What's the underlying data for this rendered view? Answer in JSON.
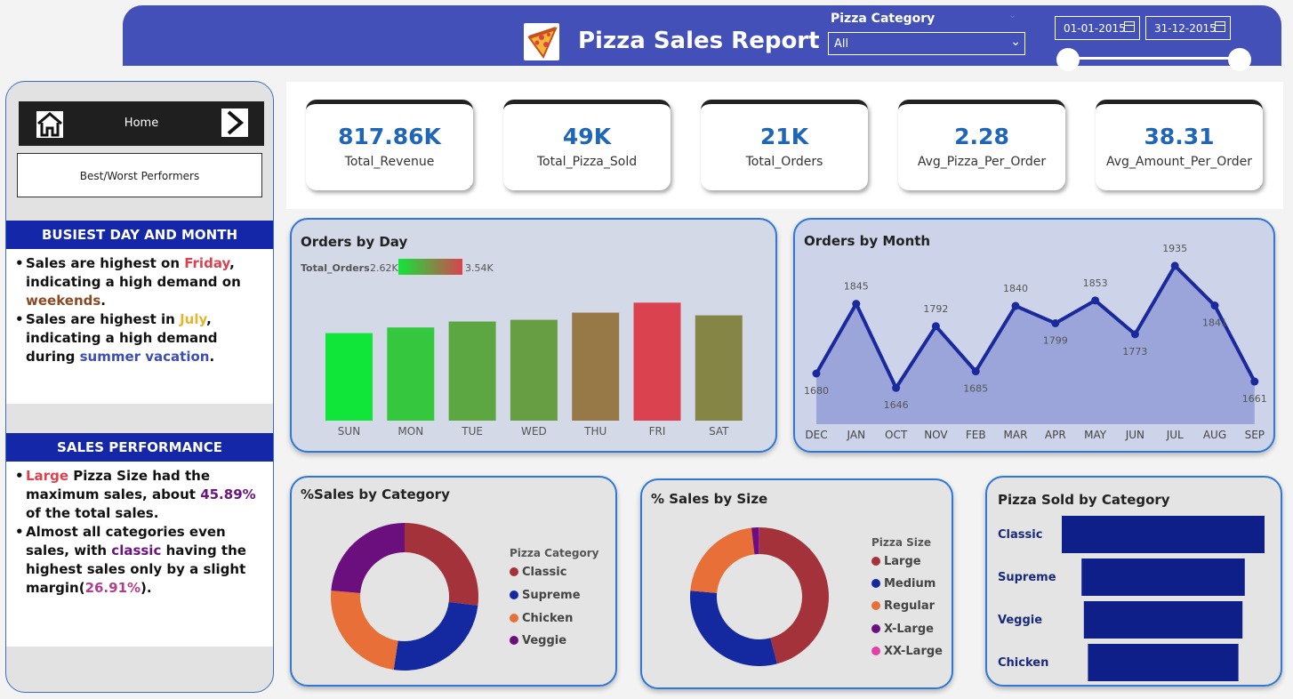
{
  "header": {
    "title": "Pizza Sales Report",
    "filter_label": "Pizza Category",
    "filter_value": "All",
    "date_start": "01-01-2015",
    "date_end": "31-12-2015"
  },
  "nav": {
    "home_label": "Home",
    "best_worst_label": "Best/Worst Performers"
  },
  "insights": {
    "busiest": {
      "title": "BUSIEST DAY AND MONTH",
      "b1_pre": "Sales are highest on ",
      "b1_hl1": "Friday",
      "b1_mid": ", indicating a high demand on ",
      "b1_hl2": "weekends",
      "b1_post": ".",
      "b2_pre": "Sales are highest in ",
      "b2_hl1": "July",
      "b2_mid": ", indicating a high demand during ",
      "b2_hl2": "summer vacation",
      "b2_post": "."
    },
    "sales_perf": {
      "title": "SALES PERFORMANCE",
      "b1_hl1": "Large",
      "b1_mid": " Pizza Size had the maximum sales, about ",
      "b1_hl2": "45.89%",
      "b1_post": " of the total sales.",
      "b2_pre": "Almost all categories even sales, with ",
      "b2_hl1": "classic",
      "b2_mid": " having the highest sales only by a slight margin(",
      "b2_hl2": "26.91%",
      "b2_post": ")."
    }
  },
  "kpis": [
    {
      "value": "817.86K",
      "label": "Total_Revenue"
    },
    {
      "value": "49K",
      "label": "Total_Pizza_Sold"
    },
    {
      "value": "21K",
      "label": "Total_Orders"
    },
    {
      "value": "2.28",
      "label": "Avg_Pizza_Per_Order"
    },
    {
      "value": "38.31",
      "label": "Avg_Amount_Per_Order"
    }
  ],
  "colors": {
    "header_bg": "#4350b8",
    "kpi_value": "#1f66b8",
    "line_series": "#1a2a9c",
    "bar_funnel": "#0f1f8a",
    "classic": "#a3323a",
    "supreme": "#1428a0",
    "chicken": "#e86f37",
    "veggie": "#6b0f7f",
    "xxlarge": "#e040a8"
  },
  "chart_data": [
    {
      "id": "orders_by_day",
      "type": "bar",
      "title": "Orders by Day",
      "color_legend": {
        "label": "Total_Orders",
        "min_label": "2.62K",
        "max_label": "3.54K",
        "min_color": "#10e63a",
        "max_color": "#d9424e"
      },
      "categories": [
        "SUN",
        "MON",
        "TUE",
        "WED",
        "THU",
        "FRI",
        "SAT"
      ],
      "values": [
        2624,
        2794,
        2973,
        3024,
        3239,
        3538,
        3158
      ],
      "ylim": [
        0,
        3600
      ]
    },
    {
      "id": "orders_by_month",
      "type": "area",
      "title": "Orders by Month",
      "categories": [
        "DEC",
        "JAN",
        "OCT",
        "NOV",
        "FEB",
        "MAR",
        "APR",
        "MAY",
        "JUN",
        "JUL",
        "AUG",
        "SEP"
      ],
      "values": [
        1680,
        1845,
        1646,
        1792,
        1685,
        1840,
        1799,
        1853,
        1773,
        1935,
        1841,
        1661
      ],
      "value_labels": [
        "1680",
        "1845",
        "1646",
        "1792",
        "1685",
        "1840",
        "1799",
        "1853",
        "1773",
        "1935",
        "1841",
        "1661"
      ],
      "ylim": [
        1560,
        1960
      ]
    },
    {
      "id": "sales_by_category",
      "type": "pie",
      "title": "%Sales by Category",
      "legend_title": "Pizza Category",
      "labels": [
        "Classic",
        "Supreme",
        "Chicken",
        "Veggie"
      ],
      "values": [
        26.91,
        25.46,
        23.96,
        23.68
      ],
      "donut": true
    },
    {
      "id": "sales_by_size",
      "type": "pie",
      "title": "% Sales by Size",
      "legend_title": "Pizza Size",
      "labels": [
        "Large",
        "Medium",
        "Regular",
        "X-Large",
        "XX-Large"
      ],
      "values": [
        45.89,
        30.49,
        21.77,
        1.72,
        0.12
      ],
      "donut": true
    },
    {
      "id": "pizza_sold_by_category",
      "type": "bar",
      "orientation": "funnel",
      "title": "Pizza Sold by Category",
      "categories": [
        "Classic",
        "Supreme",
        "Veggie",
        "Chicken"
      ],
      "values": [
        14888,
        11987,
        11649,
        11050
      ]
    }
  ]
}
